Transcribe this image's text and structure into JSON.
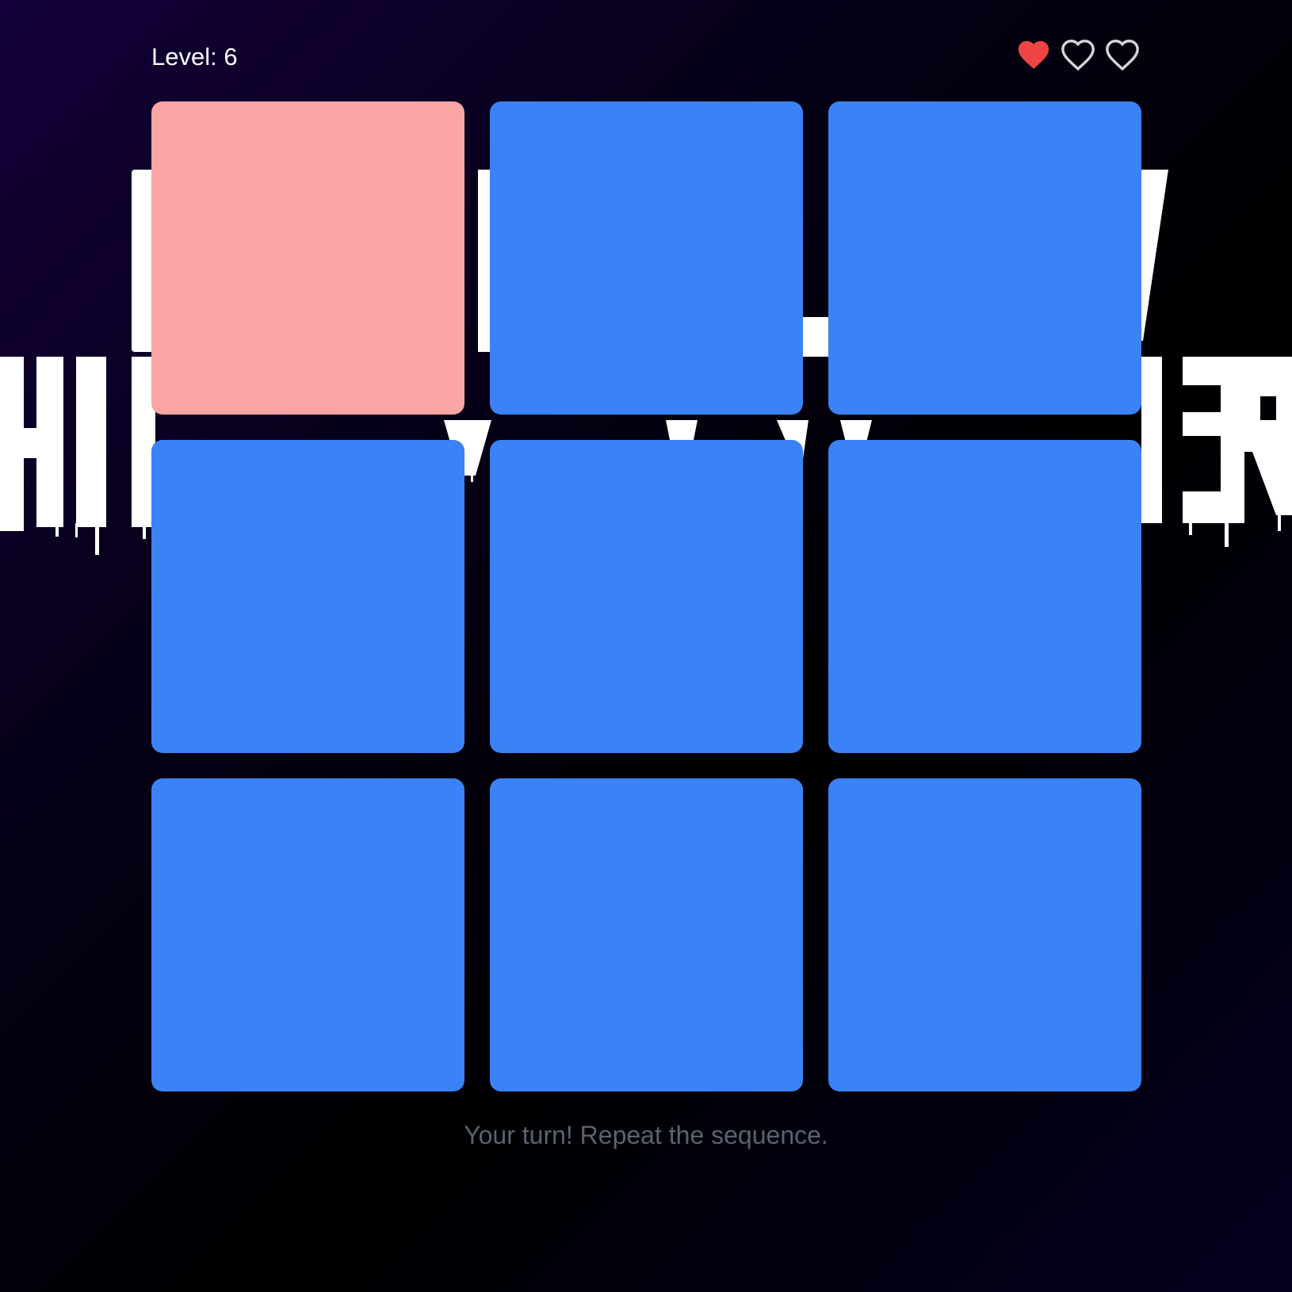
{
  "hud": {
    "level_text": "Level: 6",
    "lives_total": 3,
    "lives_remaining": 1,
    "heart_filled_color": "#ef4444",
    "heart_empty_color": "#d1d5db"
  },
  "grid": {
    "rows": 3,
    "columns": 3,
    "tiles": [
      {
        "state": "active",
        "color": "#fca5a5"
      },
      {
        "state": "idle",
        "color": "#3b82f6"
      },
      {
        "state": "idle",
        "color": "#3b82f6"
      },
      {
        "state": "idle",
        "color": "#3b82f6"
      },
      {
        "state": "idle",
        "color": "#3b82f6"
      },
      {
        "state": "idle",
        "color": "#3b82f6"
      },
      {
        "state": "idle",
        "color": "#3b82f6"
      },
      {
        "state": "idle",
        "color": "#3b82f6"
      },
      {
        "state": "idle",
        "color": "#3b82f6"
      }
    ]
  },
  "status": {
    "message": "Your turn! Repeat the sequence."
  },
  "background": {
    "banner_icon": "dripping-title-lettering"
  }
}
